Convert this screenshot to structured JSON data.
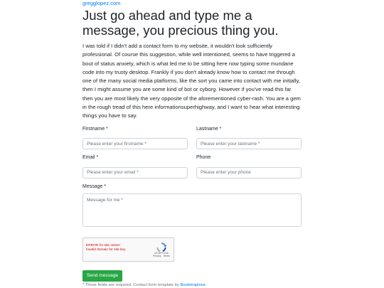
{
  "site_link": "gregglopez.com",
  "title": "Just go ahead and type me a message, you precious thing you.",
  "intro": "I was told if I didn't add a contact form to my website, it wouldn't look sufficiently professional. Of course this suggestion, while well intentioned, seems to have triggered a bout of status anxiety, which is what led me to be sitting here now typing some mundane code into my trusty desktop. Frankly if you don't already know how to contact me through one of the many social media platforms, like the sort you came into contact with me initially, then I might assume you are some kind of bot or cyborg. However if you've read this far then you are most likely the very opposite of the aforementioned cyber-rash. You are a gem in the rough tread of this here informationsuperhighway, and I want to hear what interesting things you have to say.",
  "form": {
    "firstname": {
      "label": "Firstname *",
      "placeholder": "Please enter your firstname *",
      "value": ""
    },
    "lastname": {
      "label": "Lastname *",
      "placeholder": "Please enter your lastname *",
      "value": ""
    },
    "email": {
      "label": "Email *",
      "placeholder": "Please enter your email *",
      "value": ""
    },
    "phone": {
      "label": "Phone",
      "placeholder": "Please enter your phone",
      "value": ""
    },
    "message": {
      "label": "Message *",
      "placeholder": "Message for me *",
      "value": ""
    },
    "submit_label": "Send message"
  },
  "captcha": {
    "error_line1": "ERROR for site owner:",
    "error_line2": "Invalid domain for site key",
    "brand": "reCAPTCHA",
    "links": "Privacy - Terms"
  },
  "footnote": {
    "text": "* These fields are required. Contact form template by ",
    "link": "Bootstrapious",
    "end": "."
  },
  "colors": {
    "link": "#007bff",
    "button": "#28a745",
    "error": "#d00000"
  }
}
